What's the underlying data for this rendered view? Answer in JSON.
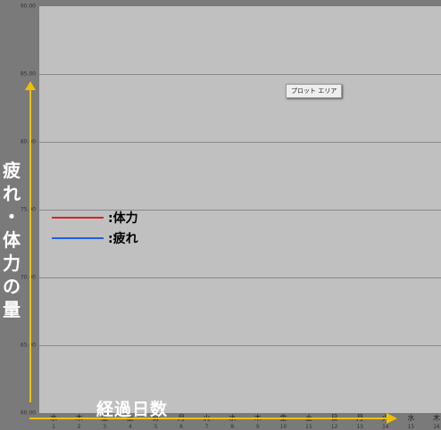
{
  "y_axis": {
    "title_chars": [
      "疲",
      "れ",
      "・",
      "体",
      "力",
      "の",
      "量"
    ],
    "tick_labels": [
      "90.00",
      "85.00",
      "80.00",
      "75.00",
      "70.00",
      "65.00",
      "60.00"
    ]
  },
  "x_axis": {
    "title": "経過日数",
    "day_labels": [
      "水",
      "木",
      "金",
      "土",
      "日",
      "月",
      "火",
      "水",
      "木",
      "金",
      "土",
      "日",
      "月",
      "火",
      "水",
      "木"
    ],
    "day_numbers": [
      "1",
      "2",
      "3",
      "4",
      "5",
      "6",
      "7",
      "8",
      "9",
      "10",
      "11",
      "12",
      "13",
      "14",
      "15",
      "16"
    ]
  },
  "legend": [
    {
      "label": ":体力",
      "color": "#e02020"
    },
    {
      "label": ":疲れ",
      "color": "#2060e0"
    }
  ],
  "tooltip": {
    "label": "プロット エリア"
  },
  "colors": {
    "background": "#7a7a7a",
    "plot_area": "#c0c0c0",
    "gridline": "#8a8a8a",
    "arrow": "#f0c000",
    "title_text": "#ffffff"
  },
  "chart_data": {
    "type": "line",
    "xlabel": "経過日数",
    "ylabel": "疲れ・体力の量",
    "ylim": [
      60,
      90
    ],
    "categories": [
      "1",
      "2",
      "3",
      "4",
      "5",
      "6",
      "7",
      "8",
      "9",
      "10",
      "11",
      "12",
      "13",
      "14",
      "15",
      "16"
    ],
    "series": [
      {
        "name": "体力",
        "values": []
      },
      {
        "name": "疲れ",
        "values": []
      }
    ],
    "grid": true,
    "legend_position": "left"
  }
}
